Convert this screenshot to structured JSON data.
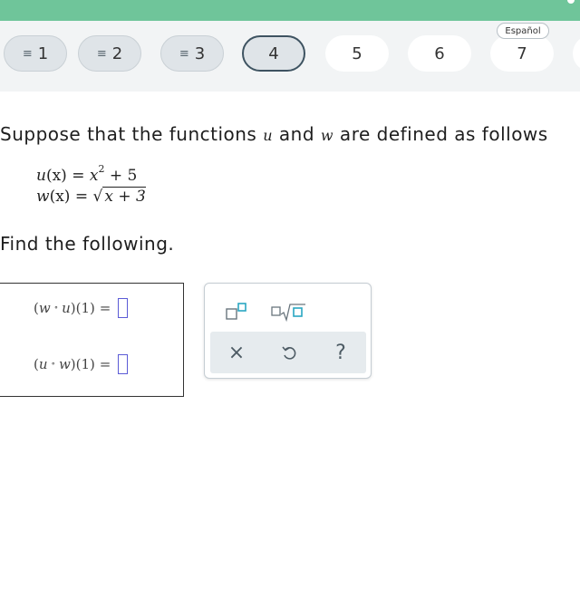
{
  "nav": {
    "questions": [
      {
        "label": "1",
        "state": "answered"
      },
      {
        "label": "2",
        "state": "answered"
      },
      {
        "label": "3",
        "state": "answered"
      },
      {
        "label": "4",
        "state": "current"
      },
      {
        "label": "5",
        "state": "unanswered"
      },
      {
        "label": "6",
        "state": "unanswered"
      },
      {
        "label": "7",
        "state": "unanswered"
      }
    ],
    "language_label": "Español"
  },
  "question": {
    "prefix": "Suppose that the functions ",
    "f1": "u",
    "mid": " and ",
    "f2": "w",
    "suffix": " are defined as follows",
    "definitions": {
      "u_lhs": "u",
      "u_arg": "(x)",
      "u_eq": " = ",
      "u_base": "x",
      "u_exp": "2",
      "u_rest": " + 5",
      "w_lhs": "w",
      "w_arg": "(x)",
      "w_eq": " = ",
      "w_radicand": "x + 3"
    },
    "instruction": "Find the following."
  },
  "answers": [
    {
      "outer": "w",
      "inner": "u",
      "arg": "(1)",
      "equals": "="
    },
    {
      "outer": "u",
      "inner": "w",
      "arg": "(1)",
      "equals": "="
    }
  ],
  "keypad": {
    "top_icons": [
      "superscript-icon",
      "nth-root-icon"
    ],
    "bottom_icons": [
      "clear-icon",
      "undo-icon",
      "help-icon"
    ],
    "help_label": "?",
    "clear_label": "×"
  },
  "colors": {
    "topbar": "#6fc59a",
    "slot_border": "#5b5bd6",
    "icon_teal": "#2aa7c2",
    "icon_gray": "#6a767e"
  }
}
